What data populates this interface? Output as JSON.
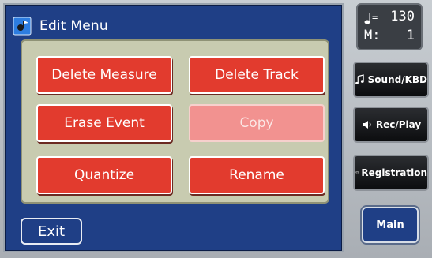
{
  "window": {
    "title": "Edit Menu",
    "icon": "edit-menu-icon"
  },
  "edit_buttons": [
    {
      "label": "Delete Measure",
      "enabled": true
    },
    {
      "label": "Delete Track",
      "enabled": true
    },
    {
      "label": "Erase Event",
      "enabled": true
    },
    {
      "label": "Copy",
      "enabled": false
    },
    {
      "label": "Quantize",
      "enabled": true
    },
    {
      "label": "Rename",
      "enabled": true
    }
  ],
  "exit_label": "Exit",
  "status": {
    "tempo_icon": "quarter-note-icon",
    "tempo_eq": "=",
    "tempo": "130",
    "measure_label": "M:",
    "measure": "1"
  },
  "side_buttons": [
    {
      "label": "Sound/KBD",
      "icon": "music-note-icon"
    },
    {
      "label": "Rec/Play",
      "icon": "speaker-icon"
    },
    {
      "label": "Registration",
      "icon": "book-icon"
    }
  ],
  "main_label": "Main",
  "colors": {
    "panel_bg": "#1f3f86",
    "button_red": "#e23b2e",
    "button_disabled": "#f29290",
    "grid_bg": "#c8cbb0"
  }
}
